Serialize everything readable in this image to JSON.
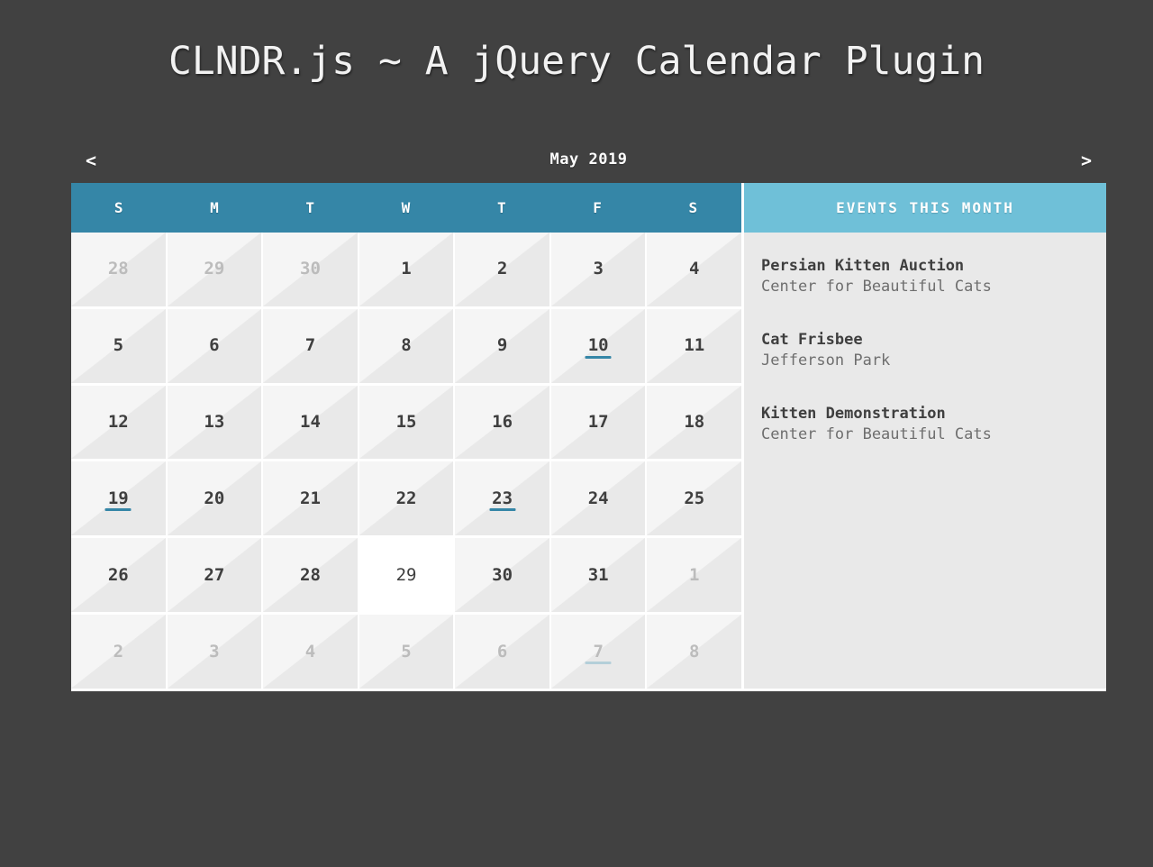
{
  "page": {
    "title": "CLNDR.js ~ A jQuery Calendar Plugin",
    "background_color": "#414141"
  },
  "calendar": {
    "controls": {
      "previous_label": "<",
      "next_label": ">",
      "month_title": "May 2019"
    },
    "colors": {
      "day_header_bg": "#3586a7",
      "events_header_bg": "#6fc0d8",
      "cell_bg": "#e9e9e9",
      "today_bg": "#ffffff",
      "event_marker": "#3586a7",
      "event_marker_adjacent": "#b4cfd9"
    },
    "days_of_week": [
      "S",
      "M",
      "T",
      "W",
      "T",
      "F",
      "S"
    ],
    "weeks": [
      [
        {
          "day": "28",
          "adjacent": true,
          "today": false,
          "has_event": false
        },
        {
          "day": "29",
          "adjacent": true,
          "today": false,
          "has_event": false
        },
        {
          "day": "30",
          "adjacent": true,
          "today": false,
          "has_event": false
        },
        {
          "day": "1",
          "adjacent": false,
          "today": false,
          "has_event": false
        },
        {
          "day": "2",
          "adjacent": false,
          "today": false,
          "has_event": false
        },
        {
          "day": "3",
          "adjacent": false,
          "today": false,
          "has_event": false
        },
        {
          "day": "4",
          "adjacent": false,
          "today": false,
          "has_event": false
        }
      ],
      [
        {
          "day": "5",
          "adjacent": false,
          "today": false,
          "has_event": false
        },
        {
          "day": "6",
          "adjacent": false,
          "today": false,
          "has_event": false
        },
        {
          "day": "7",
          "adjacent": false,
          "today": false,
          "has_event": false
        },
        {
          "day": "8",
          "adjacent": false,
          "today": false,
          "has_event": false
        },
        {
          "day": "9",
          "adjacent": false,
          "today": false,
          "has_event": false
        },
        {
          "day": "10",
          "adjacent": false,
          "today": false,
          "has_event": true
        },
        {
          "day": "11",
          "adjacent": false,
          "today": false,
          "has_event": false
        }
      ],
      [
        {
          "day": "12",
          "adjacent": false,
          "today": false,
          "has_event": false
        },
        {
          "day": "13",
          "adjacent": false,
          "today": false,
          "has_event": false
        },
        {
          "day": "14",
          "adjacent": false,
          "today": false,
          "has_event": false
        },
        {
          "day": "15",
          "adjacent": false,
          "today": false,
          "has_event": false
        },
        {
          "day": "16",
          "adjacent": false,
          "today": false,
          "has_event": false
        },
        {
          "day": "17",
          "adjacent": false,
          "today": false,
          "has_event": false
        },
        {
          "day": "18",
          "adjacent": false,
          "today": false,
          "has_event": false
        }
      ],
      [
        {
          "day": "19",
          "adjacent": false,
          "today": false,
          "has_event": true
        },
        {
          "day": "20",
          "adjacent": false,
          "today": false,
          "has_event": false
        },
        {
          "day": "21",
          "adjacent": false,
          "today": false,
          "has_event": false
        },
        {
          "day": "22",
          "adjacent": false,
          "today": false,
          "has_event": false
        },
        {
          "day": "23",
          "adjacent": false,
          "today": false,
          "has_event": true
        },
        {
          "day": "24",
          "adjacent": false,
          "today": false,
          "has_event": false
        },
        {
          "day": "25",
          "adjacent": false,
          "today": false,
          "has_event": false
        }
      ],
      [
        {
          "day": "26",
          "adjacent": false,
          "today": false,
          "has_event": false
        },
        {
          "day": "27",
          "adjacent": false,
          "today": false,
          "has_event": false
        },
        {
          "day": "28",
          "adjacent": false,
          "today": false,
          "has_event": false
        },
        {
          "day": "29",
          "adjacent": false,
          "today": true,
          "has_event": false
        },
        {
          "day": "30",
          "adjacent": false,
          "today": false,
          "has_event": false
        },
        {
          "day": "31",
          "adjacent": false,
          "today": false,
          "has_event": false
        },
        {
          "day": "1",
          "adjacent": true,
          "today": false,
          "has_event": false
        }
      ],
      [
        {
          "day": "2",
          "adjacent": true,
          "today": false,
          "has_event": false
        },
        {
          "day": "3",
          "adjacent": true,
          "today": false,
          "has_event": false
        },
        {
          "day": "4",
          "adjacent": true,
          "today": false,
          "has_event": false
        },
        {
          "day": "5",
          "adjacent": true,
          "today": false,
          "has_event": false
        },
        {
          "day": "6",
          "adjacent": true,
          "today": false,
          "has_event": false
        },
        {
          "day": "7",
          "adjacent": true,
          "today": false,
          "has_event": true
        },
        {
          "day": "8",
          "adjacent": true,
          "today": false,
          "has_event": false
        }
      ]
    ]
  },
  "events_panel": {
    "header": "EVENTS THIS MONTH",
    "items": [
      {
        "title": "Persian Kitten Auction",
        "location": "Center for Beautiful Cats"
      },
      {
        "title": "Cat Frisbee",
        "location": "Jefferson Park"
      },
      {
        "title": "Kitten Demonstration",
        "location": "Center for Beautiful Cats"
      }
    ]
  }
}
